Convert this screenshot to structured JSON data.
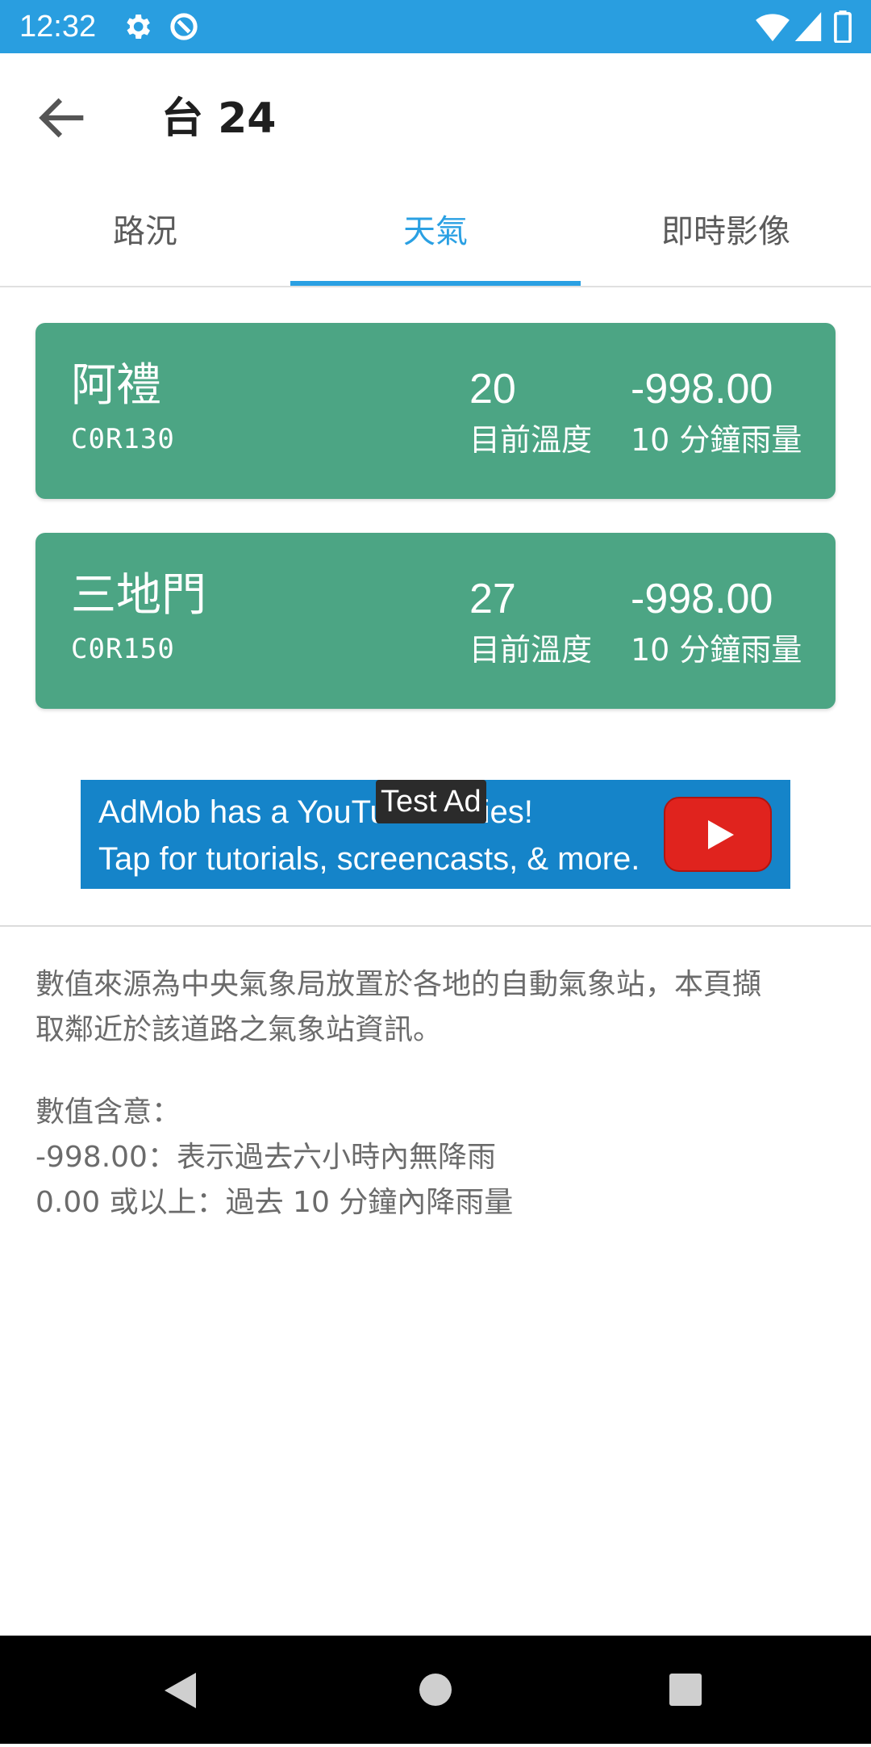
{
  "status_bar": {
    "time": "12:32",
    "icons": [
      "settings-icon",
      "data-saver-icon",
      "wifi-icon",
      "signal-icon",
      "battery-icon"
    ]
  },
  "app_bar": {
    "title": "台 24",
    "back_icon": "arrow-back-icon"
  },
  "tabs": [
    {
      "label": "路況",
      "active": false
    },
    {
      "label": "天氣",
      "active": true
    },
    {
      "label": "即時影像",
      "active": false
    }
  ],
  "stations": [
    {
      "name": "阿禮",
      "id": "C0R130",
      "temperature": "20",
      "temperature_label": "目前溫度",
      "rain": "-998.00",
      "rain_label": "10 分鐘雨量"
    },
    {
      "name": "三地門",
      "id": "C0R150",
      "temperature": "27",
      "temperature_label": "目前溫度",
      "rain": "-998.00",
      "rain_label": "10 分鐘雨量"
    }
  ],
  "ad": {
    "badge": "Test Ad",
    "line1": "AdMob has a YouTube Series!",
    "line2": "Tap for tutorials, screencasts, & more.",
    "icon": "youtube-play-icon"
  },
  "info": {
    "paragraph1_line1": "數值來源為中央氣象局放置於各地的自動氣象站，本頁擷",
    "paragraph1_line2": "取鄰近於該道路之氣象站資訊。",
    "meaning_title": "數值含意：",
    "meaning_line1": "-998.00：表示過去六小時內無降雨",
    "meaning_line2": "0.00 或以上：過去 10 分鐘內降雨量"
  },
  "colors": {
    "status_bar": "#299ee0",
    "accent": "#2aa0e3",
    "card": "#4ca584",
    "ad": "#1584c9"
  },
  "nav_bar": {
    "buttons": [
      "back-triangle-icon",
      "home-circle-icon",
      "recents-square-icon"
    ]
  }
}
